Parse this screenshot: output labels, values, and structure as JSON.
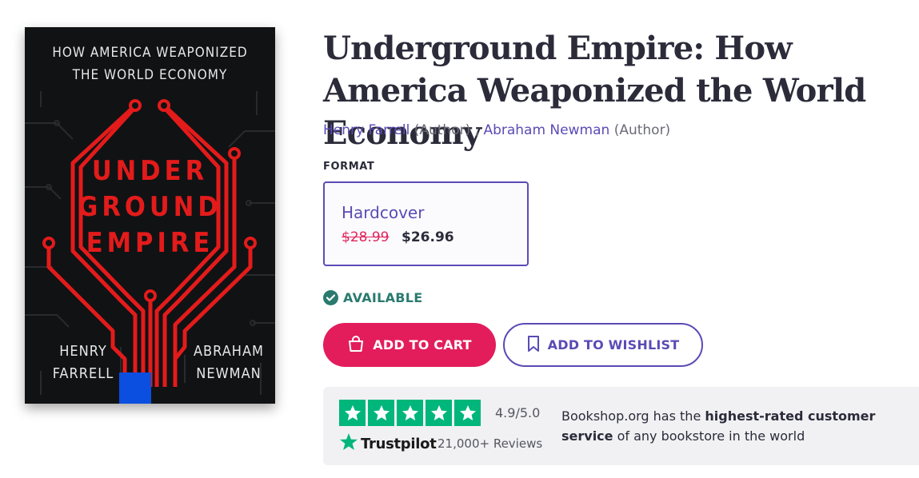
{
  "cover": {
    "subtitle_line1": "HOW AMERICA WEAPONIZED",
    "subtitle_line2": "THE WORLD ECONOMY",
    "title_line1": "UNDER",
    "title_line2": "GROUND",
    "title_line3": "EMPIRE",
    "author_left_line1": "HENRY",
    "author_left_line2": "FARRELL",
    "author_right_line1": "ABRAHAM",
    "author_right_line2": "NEWMAN",
    "circuit_color": "#e31b1b",
    "accent_color": "#0a4fe0"
  },
  "book": {
    "title": "Underground Empire: How America Weaponized the World Economy",
    "author1": "Henry Farrell",
    "author1_role": "(Author)",
    "separator": ",",
    "author2": "Abraham Newman",
    "author2_role": "(Author)"
  },
  "format": {
    "label": "FORMAT",
    "name": "Hardcover",
    "price_old": "$28.99",
    "price_new": "$26.96"
  },
  "availability": {
    "status": "AVAILABLE",
    "icon": "check-circle-icon",
    "color": "#2a7a6f"
  },
  "actions": {
    "add_to_cart": "ADD TO CART",
    "add_to_cart_icon": "shopping-bag-icon",
    "add_to_wishlist": "ADD TO WISHLIST",
    "add_to_wishlist_icon": "bookmark-icon",
    "cart_color": "#e31d5c",
    "wishlist_color": "#5a4bb5"
  },
  "trustpilot": {
    "rating": "4.9/5.0",
    "stars": 5,
    "brand": "Trustpilot",
    "reviews": "21,000+ Reviews",
    "text_before": "Bookshop.org has the ",
    "text_bold": "highest-rated customer service",
    "text_after": " of any bookstore in the world",
    "star_color": "#00b67a"
  }
}
